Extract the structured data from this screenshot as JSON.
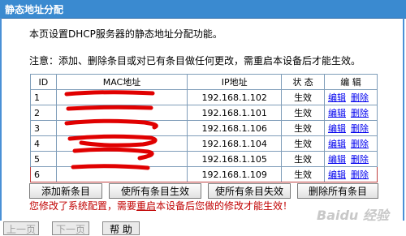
{
  "window": {
    "title": "静态地址分配"
  },
  "description": "本页设置DHCP服务器的静态地址分配功能。",
  "note": "注意：添加、删除条目或对已有条目做任何更改，需重启本设备后才能生效。",
  "table": {
    "headers": {
      "id": "ID",
      "mac": "MAC地址",
      "ip": "IP地址",
      "status": "状 态",
      "edit": "编 辑"
    },
    "rows": [
      {
        "id": "1",
        "mac": "[redacted]",
        "ip": "192.168.1.102",
        "status": "生效",
        "edit": "编辑",
        "delete": "删除"
      },
      {
        "id": "2",
        "mac": "[redacted]",
        "ip": "192.168.1.101",
        "status": "生效",
        "edit": "编辑",
        "delete": "删除"
      },
      {
        "id": "3",
        "mac": "[redacted]",
        "ip": "192.168.1.106",
        "status": "生效",
        "edit": "编辑",
        "delete": "删除"
      },
      {
        "id": "4",
        "mac": "[redacted]",
        "ip": "192.168.1.104",
        "status": "生效",
        "edit": "编辑",
        "delete": "删除"
      },
      {
        "id": "5",
        "mac": "[redacted]",
        "ip": "192.168.1.105",
        "status": "生效",
        "edit": "编辑",
        "delete": "删除"
      },
      {
        "id": "6",
        "mac": "[redacted]",
        "ip": "192.168.1.109",
        "status": "生效",
        "edit": "编辑",
        "delete": "删除"
      }
    ]
  },
  "buttons": {
    "add_new": "添加新条目",
    "enable_all": "使所有条目生效",
    "disable_all": "使所有条目失效",
    "delete_all": "删除所有条目"
  },
  "warning": {
    "before": "您修改了系统配置，需要",
    "link": "重启",
    "after": "本设备后您做的修改才能生效！"
  },
  "nav": {
    "prev": "上一页",
    "next": "下一页",
    "help": "帮 助"
  },
  "watermark": "Baidu 经验",
  "colors": {
    "title_bar": "#3a8ad0",
    "link": "#0000ee",
    "warning": "#c00000",
    "redaction": "#e00000"
  }
}
